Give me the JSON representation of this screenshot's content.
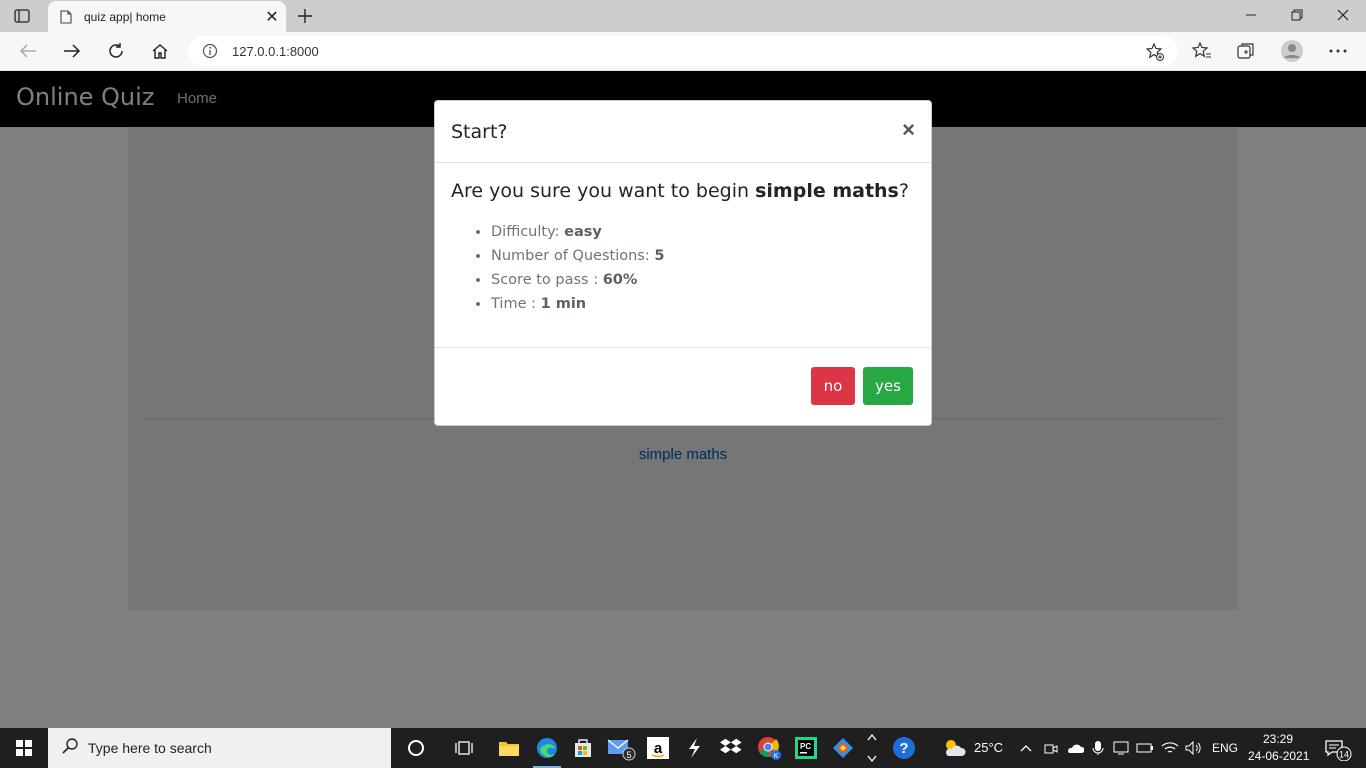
{
  "browser": {
    "tab_title": "quiz app| home",
    "url": "127.0.0.1:8000"
  },
  "page": {
    "brand": "Online Quiz",
    "nav_home": "Home",
    "quiz_link": "simple maths"
  },
  "modal": {
    "title": "Start?",
    "close": "×",
    "question_prefix": "Are you sure you want to begin ",
    "quiz_name": "simple maths",
    "question_suffix": "?",
    "details": [
      {
        "label": "Difficulty: ",
        "value": "easy"
      },
      {
        "label": "Number of Questions: ",
        "value": "5"
      },
      {
        "label": "Score to pass : ",
        "value": "60%"
      },
      {
        "label": "Time : ",
        "value": "1 min"
      }
    ],
    "no_label": "no",
    "yes_label": "yes"
  },
  "taskbar": {
    "search_placeholder": "Type here to search",
    "weather": "25°C",
    "language": "ENG",
    "time": "23:29",
    "date": "24-06-2021",
    "mail_badge": "5",
    "notification_count": "14"
  },
  "colors": {
    "no_button": "#dc3545",
    "yes_button": "#28a745",
    "link": "#0056b3"
  }
}
